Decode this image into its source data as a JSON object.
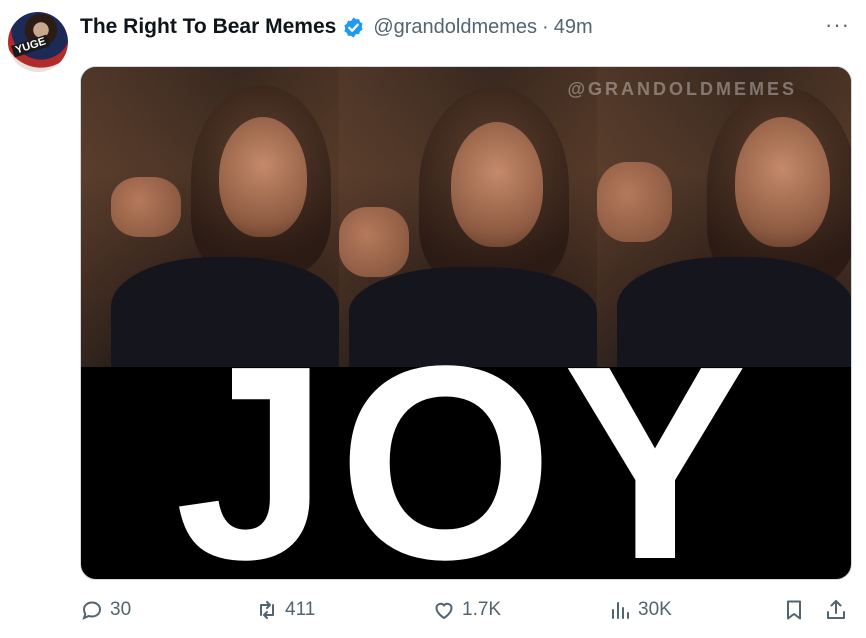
{
  "tweet": {
    "display_name": "The Right To Bear Memes",
    "handle": "@grandoldmemes",
    "separator": "·",
    "time": "49m",
    "more_label": "···",
    "avatar_text": "YUGE"
  },
  "media": {
    "watermark": "@GRANDOLDMEMES",
    "caption": "JOY"
  },
  "actions": {
    "replies": "30",
    "reposts": "411",
    "likes": "1.7K",
    "views": "30K"
  },
  "colors": {
    "verified": "#1d9bf0",
    "muted": "#536471",
    "text": "#0f1419"
  }
}
